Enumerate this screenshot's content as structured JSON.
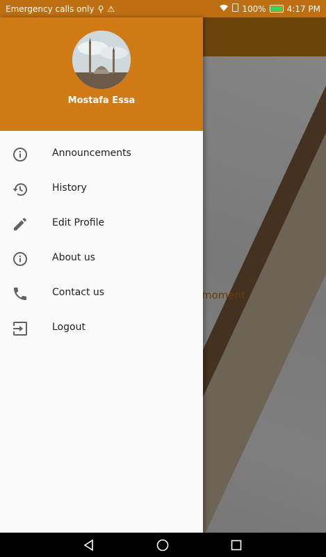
{
  "status_bar": {
    "carrier_text": "Emergency calls only",
    "battery_percent": "100%",
    "time": "4:17 PM"
  },
  "background": {
    "partial_text": "moment"
  },
  "drawer": {
    "user_name": "Mostafa Essa",
    "items": [
      {
        "label": "Announcements",
        "icon": "info-icon"
      },
      {
        "label": "History",
        "icon": "history-icon"
      },
      {
        "label": "Edit Profile",
        "icon": "pencil-icon"
      },
      {
        "label": "About us",
        "icon": "info-icon"
      },
      {
        "label": "Contact us",
        "icon": "phone-icon"
      },
      {
        "label": "Logout",
        "icon": "logout-icon"
      }
    ]
  },
  "colors": {
    "primary": "#cf7a14",
    "scrim": "rgba(0,0,0,0.45)",
    "icon": "#616161"
  }
}
